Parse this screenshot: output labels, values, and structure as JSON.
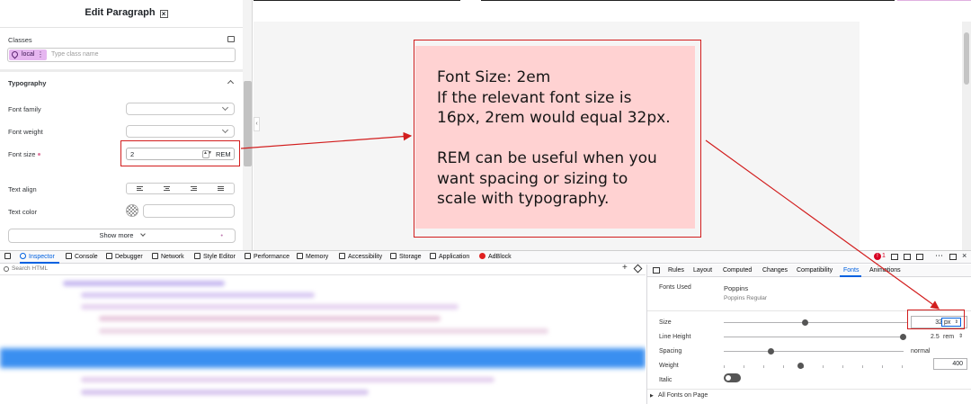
{
  "editor": {
    "title": "Edit Paragraph",
    "classes_label": "Classes",
    "class_tag": "local",
    "class_placeholder": "Type class name",
    "typography_label": "Typography",
    "font_family_label": "Font family",
    "font_weight_label": "Font weight",
    "font_size_label": "Font size",
    "font_size_value": "2",
    "font_size_unit": "REM",
    "text_align_label": "Text align",
    "text_color_label": "Text color",
    "show_more": "Show more"
  },
  "preview": {
    "line1": "Font Size: 2em",
    "line2": "If the relevant font size is",
    "line3": "16px, 2rem would equal 32px.",
    "line4": "REM can be useful when you",
    "line5": "want spacing or sizing to",
    "line6": "scale with typography."
  },
  "devtools": {
    "tabs": [
      "Inspector",
      "Console",
      "Debugger",
      "Network",
      "Style Editor",
      "Performance",
      "Memory",
      "Accessibility",
      "Storage",
      "Application",
      "AdBlock"
    ],
    "error_count": "1",
    "search_placeholder": "Search HTML",
    "panel_tabs": [
      "Rules",
      "Layout",
      "Computed",
      "Changes",
      "Compatibility",
      "Fonts",
      "Animations"
    ],
    "fonts": {
      "fonts_used_label": "Fonts Used",
      "font_name": "Poppins",
      "font_variant": "Poppins Regular",
      "size_label": "Size",
      "size_value": "32",
      "size_unit": "px",
      "line_height_label": "Line Height",
      "line_height_value": "2.5",
      "line_height_unit": "rem",
      "spacing_label": "Spacing",
      "spacing_value": "normal",
      "weight_label": "Weight",
      "weight_value": "400",
      "italic_label": "Italic",
      "all_fonts_label": "All Fonts on Page"
    }
  },
  "colors": {
    "accent_blue": "#0061e0",
    "annotation_red": "#d21d1d",
    "preview_pink": "#ffd2d2",
    "local_tag": "#e6b6f0"
  }
}
